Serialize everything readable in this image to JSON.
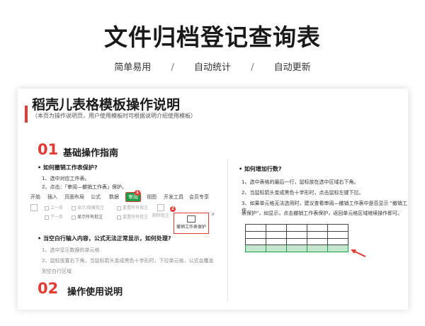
{
  "header": {
    "title": "文件归档登记查询表",
    "features": [
      "简单易用",
      "自动统计",
      "自动更新"
    ],
    "separator": "/"
  },
  "card": {
    "title": "稻壳儿表格模板操作说明",
    "note": "（本页为操作说明页，用户使用模板时可根据说明介绍使用模板）",
    "section1": {
      "num": "01",
      "title": "基础操作指南"
    },
    "section2": {
      "num": "02",
      "title": "操作使用说明"
    },
    "q1": {
      "title": "•  如何撤销工作表保护?",
      "steps": [
        "1、选中对应工作表。",
        "2、点击：「审阅—撤销工作表」保护。"
      ]
    },
    "ribbon": {
      "tabs": [
        "开始",
        "插入",
        "页面布局",
        "公式",
        "数据",
        "审阅",
        "视图",
        "开发工具",
        "会员专享"
      ],
      "active_tab": "审阅",
      "tools_row1": [
        "上一条",
        "显示/隐藏批注",
        "重置所有批注"
      ],
      "tools_row2": [
        "下一条",
        "显示所有批注",
        "重置所有批注"
      ],
      "big_tools": [
        "删除批注",
        "创建工作区"
      ],
      "protect_label": "撤销工作表保护",
      "badge1": "1",
      "badge2": "2",
      "arrow_icon": "P"
    },
    "q2": {
      "title": "•  当空白行输入内容，公式无法正常显示，如何处理?",
      "steps": [
        "1、选中显示数据的单元格",
        "2、鼠标放置右下角，当鼠标箭头变成黑色十字形时，下拉单元格，公式会覆盖",
        "到空白行区域"
      ]
    },
    "q3": {
      "title": "•  如何增加行数?",
      "steps": [
        "1、选中表格的最后一行，鼠标放在选中区域右下角。",
        "2、当鼠标箭头变成黑色十字形时，点击鼠标左键下拉。",
        "3、如果单元格无法选用时，建议查看审阅—撤销工作表中是否显示 \"撤销工作",
        "表保护\"，如显示，点击撤销工作表保护，返回单元格区域继续操作即可。"
      ]
    }
  },
  "colors": {
    "accent": "#e23b33",
    "green": "#1f9a45",
    "highlight": "#c6e7cf"
  }
}
